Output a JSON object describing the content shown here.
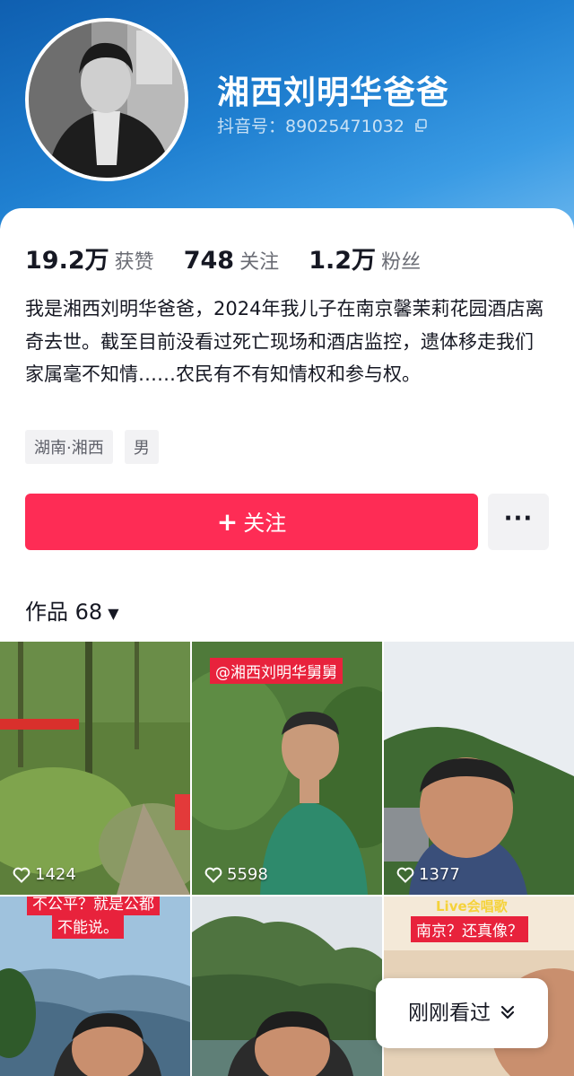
{
  "profile": {
    "nickname": "湘西刘明华爸爸",
    "douyin_id": "抖音号：89025471032",
    "bio": "我是湘西刘明华爸爸，2024年我儿子在南京馨茉莉花园酒店离奇去世。截至目前没看过死亡现场和酒店监控，遗体移走我们家属毫不知情……农民有不有知情权和参与权。",
    "tags": [
      "湖南·湘西",
      "男"
    ]
  },
  "stats": [
    {
      "value": "19.2万",
      "label": "获赞"
    },
    {
      "value": "748",
      "label": "关注"
    },
    {
      "value": "1.2万",
      "label": "粉丝"
    }
  ],
  "actions": {
    "follow_plus": "+",
    "follow_label": "关注",
    "more_label": "···"
  },
  "works": {
    "label": "作品",
    "count": "68",
    "dropdown_glyph": "▼"
  },
  "videos": [
    {
      "likes": "1424",
      "caption": ""
    },
    {
      "likes": "5598",
      "caption": "@湘西刘明华舅舅"
    },
    {
      "likes": "1377",
      "caption": ""
    },
    {
      "likes": "",
      "caption": "不能说。",
      "caption_top": "不公平？就是公都"
    },
    {
      "likes": "",
      "caption": ""
    },
    {
      "likes": "",
      "caption": "南京？还真像？",
      "caption_top": "Live会唱歌"
    }
  ],
  "recent": {
    "label": "刚刚看过"
  },
  "colors": {
    "accent": "#fe2c55",
    "header_blue": "#1f7fd0",
    "text_primary": "#161823",
    "text_secondary": "#6b6d75"
  },
  "icons": [
    "copy-icon",
    "heart-icon",
    "chevron-double-down-icon",
    "plus-icon",
    "more-icon"
  ]
}
